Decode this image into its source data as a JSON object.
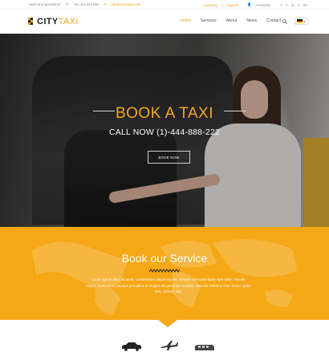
{
  "topbar": {
    "question": "Have any Questions?",
    "phone": "+01 123 444 555",
    "email": "info@company.com",
    "links": [
      "Company",
      "Support"
    ],
    "login": "Anmelden",
    "social": [
      "f",
      "t",
      "in",
      "t",
      "G+"
    ]
  },
  "header": {
    "logo_main": "CITY",
    "logo_accent": "TAXI",
    "nav": [
      "Home",
      "Services",
      "About",
      "News",
      "Contact"
    ],
    "active_nav": "Home"
  },
  "hero": {
    "title": "BOOK A TAXI",
    "subtitle": "CALL NOW (1)-444-888-222",
    "button": "BOOK NOW"
  },
  "service": {
    "title": "Book our Service",
    "text": "Lorem ipsum dolor sit amet, consectetuer adipiscing elit. Aenean commodo ligula eget dolor. Aenean massa. Cum sociis natoque penatibus et magnis dis parturient montes, nascetur ridiculus mus. Donec quam felis, ultricies nec."
  },
  "colors": {
    "accent": "#f5a623",
    "service_bg": "#f5a716"
  }
}
